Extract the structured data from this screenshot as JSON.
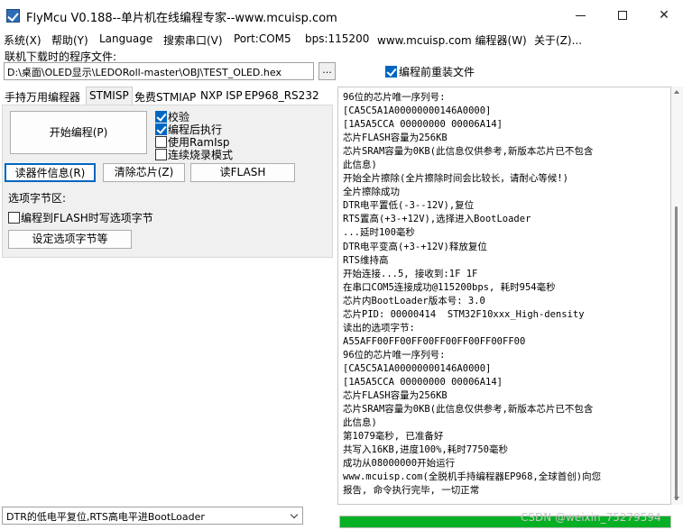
{
  "window": {
    "title": "FlyMcu V0.188--单片机在线编程专家--www.mcuisp.com",
    "minimize_icon": "minimize-icon",
    "maximize_icon": "maximize-icon",
    "close_icon": "close-icon",
    "close_glyph": "✕"
  },
  "menu": [
    "系统(X)",
    "帮助(Y)",
    "Language",
    "搜索串口(V)",
    "Port:COM5",
    "bps:115200",
    "www.mcuisp.com 编程器(W)",
    "关于(Z)..."
  ],
  "program_file": {
    "label": "联机下载时的程序文件:",
    "path": "D:\\桌面\\OLED显示\\LEDORoll-master\\OBJ\\TEST_OLED.hex",
    "browse_label": "...",
    "reload_label": "编程前重装文件",
    "reload_checked": true
  },
  "tabs": [
    "手持万用编程器",
    "STMISP",
    "免费STMIAP",
    "NXP ISP",
    "EP968_RS232"
  ],
  "active_tab": "STMISP",
  "stmisp": {
    "start_button": "开始编程(P)",
    "options": [
      {
        "label": "校验",
        "checked": true
      },
      {
        "label": "编程后执行",
        "checked": true
      },
      {
        "label": "使用RamIsp",
        "checked": false
      },
      {
        "label": "连续烧录模式",
        "checked": false
      }
    ],
    "read_info_button": "读器件信息(R)",
    "erase_button": "清除芯片(Z)",
    "read_flash_button": "读FLASH",
    "option_bytes_label": "选项字节区:",
    "flash_option_check": {
      "label": "编程到FLASH时写选项字节",
      "checked": false
    },
    "set_option_button": "设定选项字节等"
  },
  "reset_mode": {
    "selected": "DTR的低电平复位,RTS高电平进BootLoader"
  },
  "log_lines": [
    "96位的芯片唯一序列号:",
    "[CA5C5A1A00000000146A0000]",
    "[1A5A5CCA 00000000 00006A14]",
    "芯片FLASH容量为256KB",
    "芯片SRAM容量为0KB(此信息仅供参考,新版本芯片已不包含",
    "此信息)",
    "开始全片擦除(全片擦除时间会比较长，请耐心等候!)",
    "全片擦除成功",
    "DTR电平置低(-3--12V),复位",
    "RTS置高(+3-+12V),选择进入BootLoader",
    "...延时100毫秒",
    "DTR电平变高(+3-+12V)释放复位",
    "RTS维持高",
    "开始连接...5, 接收到:1F 1F",
    "在串口COM5连接成功@115200bps, 耗时954毫秒",
    "芯片内BootLoader版本号: 3.0",
    "芯片PID: 00000414  STM32F10xxx_High-density",
    "读出的选项字节:",
    "A55AFF00FF00FF00FF00FF00FF00FF00",
    "96位的芯片唯一序列号:",
    "[CA5C5A1A00000000146A0000]",
    "[1A5A5CCA 00000000 00006A14]",
    "芯片FLASH容量为256KB",
    "芯片SRAM容量为0KB(此信息仅供参考,新版本芯片已不包含",
    "此信息)",
    "第1079毫秒, 已准备好",
    "共写入16KB,进度100%,耗时7750毫秒",
    "成功从08000000开始运行",
    "www.mcuisp.com(全脱机手持编程器EP968,全球首创)向您",
    "报告, 命令执行完毕, 一切正常"
  ],
  "progress": {
    "value": 1.0,
    "color": "#06b025"
  },
  "watermark": "CSDN @weixin_75279594",
  "colors": {
    "accent": "#0067c0",
    "progress": "#06b025"
  }
}
